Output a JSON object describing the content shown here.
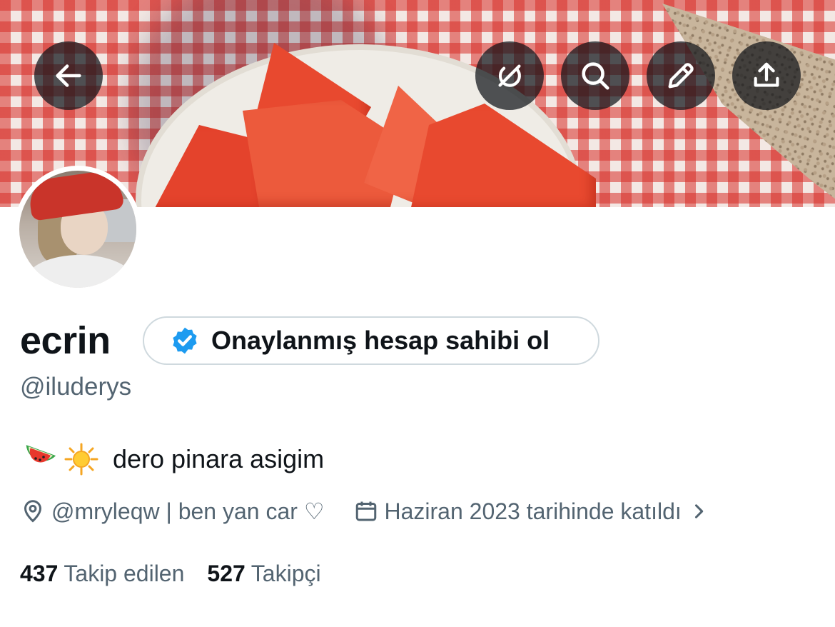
{
  "profile": {
    "name": "ecrin",
    "handle": "@iluderys",
    "verify_label": "Onaylanmış hesap sahibi ol",
    "bio": "dero pinara asigim",
    "bio_emojis": [
      "watermelon-emoji",
      "sun-emoji"
    ],
    "location": "@mryleqw | ben yan car ♡",
    "joined": "Haziran 2023 tarihinde katıldı",
    "following_count": "437",
    "following_label": "Takip edilen",
    "followers_count": "527",
    "followers_label": "Takipçi"
  },
  "header_buttons": [
    "back-arrow-icon",
    "grok-icon",
    "search-icon",
    "edit-pencil-icon",
    "share-icon"
  ],
  "colors": {
    "text": "#0f1419",
    "muted": "#536471",
    "verified": "#1d9bf0",
    "pill_border": "#cfd9de"
  }
}
